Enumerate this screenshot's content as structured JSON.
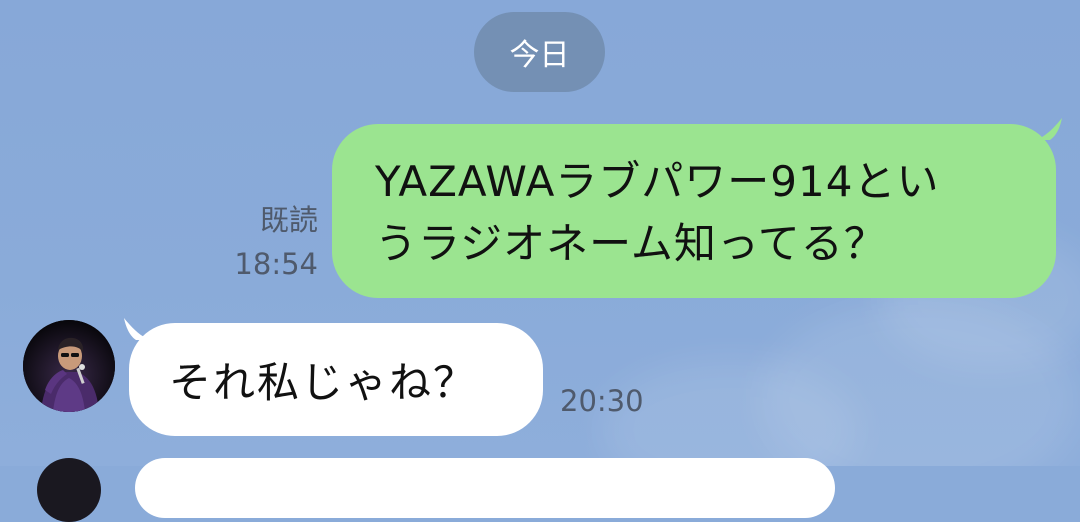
{
  "date_separator": "今日",
  "messages": [
    {
      "direction": "outgoing",
      "lines": [
        "YAZAWAラブパワー914とい",
        "うラジオネーム知ってる？"
      ],
      "read_label": "既読",
      "time": "18:54",
      "bubble_color": "#9be490"
    },
    {
      "direction": "incoming",
      "text": "それ私じゃね？",
      "time": "20:30",
      "avatar": "performer-with-microphone-photo",
      "bubble_color": "#ffffff"
    }
  ],
  "colors": {
    "background": "#8aabd9",
    "date_pill": "#7490b4",
    "meta_text": "#4f5a6c"
  }
}
